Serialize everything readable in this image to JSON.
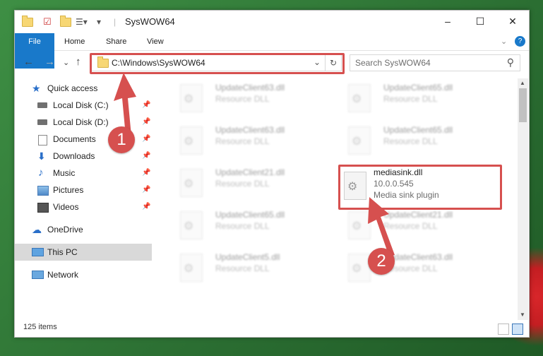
{
  "window": {
    "title": "SysWOW64",
    "controls": {
      "minimize": "–",
      "maximize": "☐",
      "close": "✕"
    }
  },
  "ribbon": {
    "tabs": [
      {
        "label": "File"
      },
      {
        "label": "Home"
      },
      {
        "label": "Share"
      },
      {
        "label": "View"
      }
    ],
    "expand": "⌄",
    "help": "?"
  },
  "address": {
    "path": "C:\\Windows\\SysWOW64",
    "dropdown": "⌄",
    "refresh": "↻",
    "back": "←",
    "forward": "→",
    "recent": "⌄",
    "up": "↑"
  },
  "search": {
    "placeholder": "Search SysWOW64",
    "icon": "⚲"
  },
  "nav": {
    "items": [
      {
        "label": "Quick access",
        "icon": "star-icon",
        "pinned": false
      },
      {
        "label": "Local Disk (C:)",
        "icon": "drive-icon",
        "pinned": true
      },
      {
        "label": "Local Disk (D:)",
        "icon": "drive-icon",
        "pinned": true
      },
      {
        "label": "Documents",
        "icon": "documents-icon",
        "pinned": true
      },
      {
        "label": "Downloads",
        "icon": "download-icon",
        "pinned": true
      },
      {
        "label": "Music",
        "icon": "music-icon",
        "pinned": true
      },
      {
        "label": "Pictures",
        "icon": "pictures-icon",
        "pinned": true
      },
      {
        "label": "Videos",
        "icon": "videos-icon",
        "pinned": true
      },
      {
        "label": "OneDrive",
        "icon": "cloud-icon",
        "pinned": false
      },
      {
        "label": "This PC",
        "icon": "computer-icon",
        "pinned": false,
        "selected": true
      },
      {
        "label": "Network",
        "icon": "network-icon",
        "pinned": false
      }
    ],
    "pin_glyph": "📌"
  },
  "files": [
    {
      "name": "UpdateClient63.dll",
      "desc": "Resource DLL"
    },
    {
      "name": "UpdateClient65.dll",
      "desc": "Resource DLL"
    },
    {
      "name": "UpdateClient63.dll",
      "desc": "Resource DLL"
    },
    {
      "name": "UpdateClient65.dll",
      "desc": "Resource DLL"
    },
    {
      "name": "UpdateClient21.dll",
      "desc": "Resource DLL"
    },
    {
      "name": "mediasink.dll",
      "version": "10.0.0.545",
      "desc": "Media sink plugin",
      "highlighted": true
    },
    {
      "name": "UpdateClient65.dll",
      "desc": "Resource DLL"
    },
    {
      "name": "UpdateClient21.dll",
      "desc": "Resource DLL"
    },
    {
      "name": "UpdateClient5.dll",
      "desc": "Resource DLL"
    },
    {
      "name": "UpdateClient63.dll",
      "desc": "Resource DLL"
    }
  ],
  "status": {
    "items": "125 items"
  },
  "annotations": [
    {
      "label": "1"
    },
    {
      "label": "2"
    }
  ],
  "colors": {
    "accent": "#1979ca",
    "annotation": "#d6504f"
  }
}
